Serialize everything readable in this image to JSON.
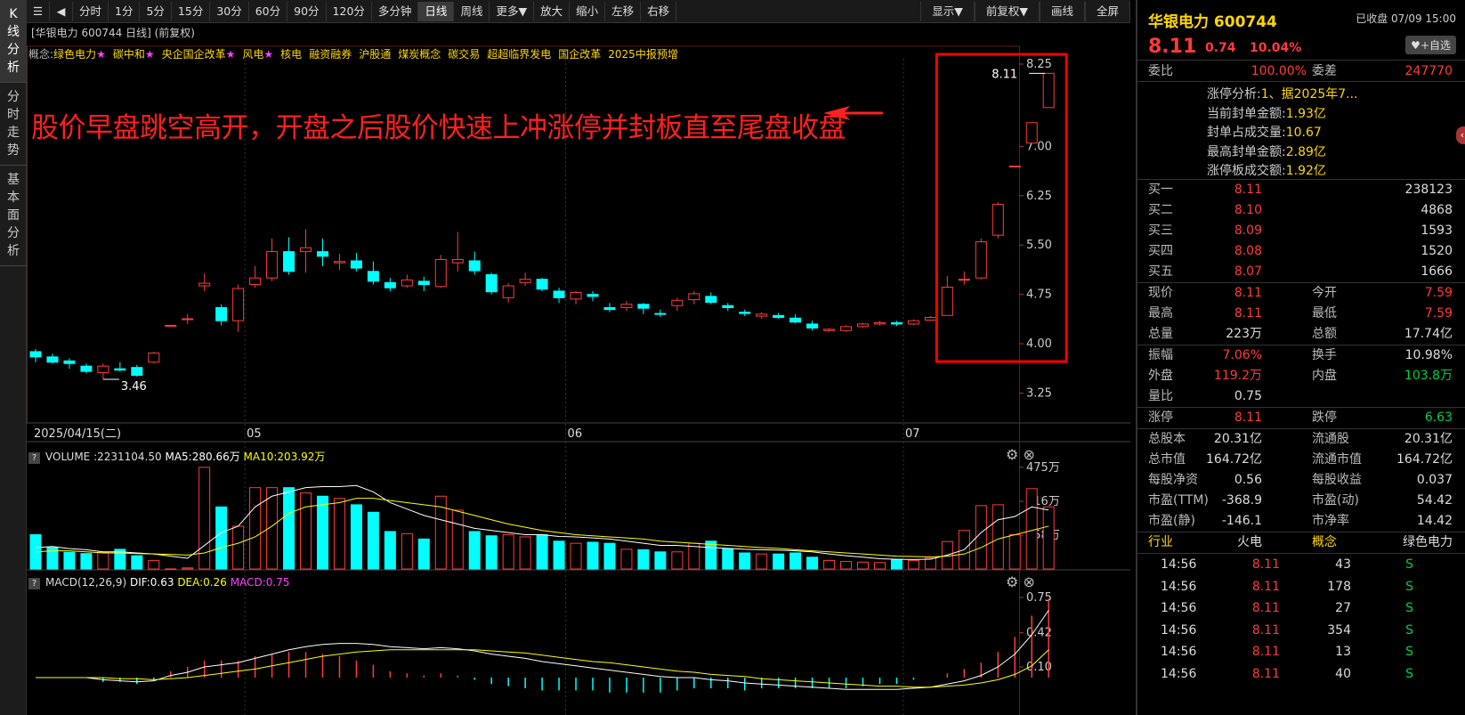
{
  "sidetabs": [
    "K线分析",
    "分时走势",
    "基本面分析"
  ],
  "toolbar": {
    "items": [
      "分时",
      "1分",
      "5分",
      "15分",
      "30分",
      "60分",
      "90分",
      "120分",
      "多分钟",
      "日线",
      "周线",
      "更多▼",
      "放大",
      "缩小",
      "左移",
      "右移"
    ],
    "active": "日线",
    "right": [
      "显示▼",
      "前复权▼",
      "画线",
      "全屏"
    ]
  },
  "chart_header": "[华银电力 600744 日线] (前复权)",
  "concepts": {
    "label": "概念:",
    "items": [
      {
        "t": "绿色电力",
        "star": true
      },
      {
        "t": "碳中和",
        "star": true
      },
      {
        "t": "央企国企改革",
        "star": true
      },
      {
        "t": "风电",
        "star": true
      },
      {
        "t": "核电",
        "star": false
      },
      {
        "t": "融资融券",
        "star": false
      },
      {
        "t": "沪股通",
        "star": false
      },
      {
        "t": "煤炭概念",
        "star": false
      },
      {
        "t": "碳交易",
        "star": false
      },
      {
        "t": "超超临界发电",
        "star": false
      },
      {
        "t": "国企改革",
        "star": false
      },
      {
        "t": "2025中报预增",
        "star": false
      }
    ]
  },
  "annotation": "股价早盘跳空高开，开盘之后股价快速上冲涨停并封板直至尾盘收盘",
  "price_axis": [
    "8.25",
    "7.00",
    "6.25",
    "5.50",
    "4.75",
    "4.00",
    "3.25"
  ],
  "date_axis": [
    "2025/04/15(二)",
    "05",
    "06",
    "07"
  ],
  "price_labels": {
    "high": "8.11",
    "low": "3.46"
  },
  "volume_panel": {
    "title": "VOLUME",
    "vol": ":2231104.50",
    "ma5": "MA5:280.66万",
    "ma10": "MA10:203.92万",
    "axis": [
      "475万",
      "316万",
      "158万"
    ]
  },
  "macd_panel": {
    "title": "MACD(12,26,9)",
    "dif": "DIF:0.63",
    "dea": "DEA:0.26",
    "macd": "MACD:0.75",
    "axis": [
      "0.75",
      "0.42",
      "0.10"
    ]
  },
  "colors": {
    "up": "#ff3b3b",
    "down": "#00ffff",
    "ma5": "#ffffff",
    "ma10": "#ffff00",
    "highlight": "#ff0000"
  },
  "chart_data": {
    "type": "candlestick",
    "candles": [
      [
        3.88,
        3.8,
        3.92,
        3.72
      ],
      [
        3.8,
        3.72,
        3.85,
        3.7
      ],
      [
        3.74,
        3.7,
        3.78,
        3.62
      ],
      [
        3.66,
        3.58,
        3.7,
        3.55
      ],
      [
        3.56,
        3.66,
        3.7,
        3.46
      ],
      [
        3.62,
        3.6,
        3.72,
        3.58
      ],
      [
        3.64,
        3.52,
        3.68,
        3.5
      ],
      [
        3.72,
        3.86,
        3.88,
        3.7
      ],
      [
        4.28,
        4.28,
        4.28,
        4.28
      ],
      [
        4.37,
        4.38,
        4.45,
        4.3
      ],
      [
        4.88,
        4.92,
        5.07,
        4.8
      ],
      [
        4.55,
        4.35,
        4.6,
        4.28
      ],
      [
        4.35,
        4.84,
        4.9,
        4.18
      ],
      [
        4.9,
        5.0,
        5.18,
        4.85
      ],
      [
        5.0,
        5.4,
        5.6,
        4.95
      ],
      [
        5.4,
        5.1,
        5.62,
        5.05
      ],
      [
        5.4,
        5.46,
        5.74,
        5.08
      ],
      [
        5.4,
        5.33,
        5.6,
        5.18
      ],
      [
        5.23,
        5.25,
        5.37,
        5.12
      ],
      [
        5.26,
        5.15,
        5.38,
        5.1
      ],
      [
        5.1,
        4.95,
        5.25,
        4.9
      ],
      [
        4.93,
        4.85,
        5.0,
        4.8
      ],
      [
        4.88,
        4.97,
        5.05,
        4.85
      ],
      [
        4.95,
        4.9,
        5.02,
        4.8
      ],
      [
        4.87,
        5.28,
        5.35,
        4.85
      ],
      [
        5.23,
        5.28,
        5.7,
        5.1
      ],
      [
        5.26,
        5.11,
        5.4,
        5.05
      ],
      [
        5.05,
        4.79,
        5.08,
        4.75
      ],
      [
        4.7,
        4.88,
        4.92,
        4.62
      ],
      [
        4.93,
        4.98,
        5.08,
        4.88
      ],
      [
        4.98,
        4.83,
        5.0,
        4.8
      ],
      [
        4.8,
        4.7,
        4.85,
        4.62
      ],
      [
        4.68,
        4.78,
        4.8,
        4.6
      ],
      [
        4.75,
        4.72,
        4.8,
        4.65
      ],
      [
        4.55,
        4.52,
        4.62,
        4.48
      ],
      [
        4.55,
        4.6,
        4.65,
        4.5
      ],
      [
        4.6,
        4.54,
        4.62,
        4.45
      ],
      [
        4.46,
        4.45,
        4.52,
        4.41
      ],
      [
        4.58,
        4.66,
        4.7,
        4.5
      ],
      [
        4.67,
        4.76,
        4.8,
        4.6
      ],
      [
        4.72,
        4.63,
        4.78,
        4.6
      ],
      [
        4.58,
        4.55,
        4.62,
        4.5
      ],
      [
        4.48,
        4.46,
        4.52,
        4.42
      ],
      [
        4.42,
        4.45,
        4.48,
        4.38
      ],
      [
        4.43,
        4.4,
        4.47,
        4.38
      ],
      [
        4.39,
        4.33,
        4.45,
        4.31
      ],
      [
        4.3,
        4.24,
        4.35,
        4.2
      ],
      [
        4.2,
        4.22,
        4.24,
        4.18
      ],
      [
        4.2,
        4.26,
        4.28,
        4.18
      ],
      [
        4.26,
        4.3,
        4.32,
        4.24
      ],
      [
        4.3,
        4.32,
        4.35,
        4.28
      ],
      [
        4.32,
        4.3,
        4.35,
        4.27
      ],
      [
        4.3,
        4.35,
        4.37,
        4.28
      ],
      [
        4.36,
        4.4,
        4.42,
        4.35
      ],
      [
        4.43,
        4.86,
        5.03,
        4.43
      ],
      [
        4.98,
        4.98,
        5.1,
        4.9
      ],
      [
        5.0,
        5.55,
        5.6,
        4.98
      ],
      [
        5.65,
        6.12,
        6.15,
        5.6
      ],
      [
        6.7,
        6.7,
        6.7,
        6.7
      ],
      [
        7.05,
        7.36,
        7.36,
        7.05
      ],
      [
        7.59,
        8.11,
        8.11,
        7.59
      ]
    ],
    "volume": [
      160,
      100,
      78,
      72,
      78,
      92,
      62,
      40,
      0.5,
      5,
      475,
      290,
      200,
      380,
      380,
      380,
      355,
      340,
      330,
      300,
      265,
      175,
      165,
      140,
      340,
      275,
      175,
      155,
      160,
      150,
      160,
      130,
      120,
      125,
      120,
      92,
      90,
      80,
      80,
      120,
      130,
      95,
      75,
      70,
      70,
      75,
      55,
      40,
      35,
      32,
      30,
      45,
      40,
      50,
      128,
      180,
      296,
      300,
      160,
      375,
      290
    ],
    "ma5": [
      100,
      105,
      95,
      90,
      80,
      80,
      75,
      70,
      60,
      50,
      110,
      170,
      200,
      290,
      340,
      360,
      380,
      385,
      385,
      390,
      360,
      310,
      280,
      250,
      230,
      210,
      190,
      180,
      170,
      160,
      160,
      152,
      150,
      145,
      140,
      130,
      120,
      110,
      110,
      105,
      100,
      96,
      92,
      90,
      88,
      85,
      80,
      70,
      62,
      55,
      48,
      45,
      44,
      46,
      65,
      90,
      170,
      230,
      245,
      290,
      275
    ],
    "ma10": [
      80,
      85,
      85,
      80,
      75,
      75,
      72,
      70,
      68,
      65,
      75,
      100,
      120,
      150,
      200,
      260,
      290,
      300,
      310,
      330,
      330,
      320,
      310,
      300,
      290,
      270,
      250,
      230,
      210,
      195,
      180,
      170,
      160,
      155,
      150,
      145,
      140,
      130,
      125,
      120,
      115,
      110,
      105,
      100,
      96,
      90,
      85,
      80,
      75,
      70,
      65,
      60,
      58,
      56,
      60,
      70,
      100,
      140,
      160,
      180,
      200
    ],
    "macd": {
      "dif": [
        0,
        0,
        0,
        0,
        -0.02,
        -0.03,
        -0.04,
        -0.03,
        0.02,
        0.05,
        0.1,
        0.12,
        0.14,
        0.18,
        0.22,
        0.26,
        0.29,
        0.31,
        0.32,
        0.32,
        0.31,
        0.29,
        0.28,
        0.27,
        0.28,
        0.27,
        0.25,
        0.22,
        0.2,
        0.18,
        0.15,
        0.13,
        0.11,
        0.09,
        0.07,
        0.05,
        0.03,
        0.01,
        0,
        0,
        -0.02,
        -0.03,
        -0.05,
        -0.06,
        -0.07,
        -0.08,
        -0.09,
        -0.1,
        -0.11,
        -0.11,
        -0.11,
        -0.11,
        -0.1,
        -0.09,
        -0.06,
        -0.03,
        0.02,
        0.1,
        0.22,
        0.4,
        0.63
      ],
      "dea": [
        0,
        0,
        0,
        0,
        0,
        -0.01,
        -0.01,
        -0.02,
        -0.01,
        0,
        0.02,
        0.04,
        0.06,
        0.08,
        0.11,
        0.14,
        0.17,
        0.2,
        0.22,
        0.24,
        0.25,
        0.26,
        0.26,
        0.26,
        0.26,
        0.26,
        0.26,
        0.25,
        0.24,
        0.23,
        0.21,
        0.19,
        0.17,
        0.15,
        0.14,
        0.12,
        0.1,
        0.08,
        0.06,
        0.05,
        0.03,
        0.02,
        0.01,
        -0.01,
        -0.02,
        -0.03,
        -0.04,
        -0.05,
        -0.06,
        -0.07,
        -0.08,
        -0.08,
        -0.09,
        -0.09,
        -0.08,
        -0.07,
        -0.05,
        -0.02,
        0.03,
        0.11,
        0.26
      ]
    },
    "ylim": [
      3.25,
      8.25
    ]
  },
  "right_panel": {
    "name": "华银电力 600744",
    "status": "已收盘 07/09 15:00",
    "price": "8.11",
    "change": "0.74",
    "pct": "10.04%",
    "add_btn": "+自选",
    "weibi": {
      "k1": "委比",
      "v1": "100.00%",
      "k2": "委差",
      "v2": "247770"
    },
    "limit": [
      {
        "k": "涨停分析:",
        "v": "1、据2025年7..."
      },
      {
        "k": "当前封单金额:",
        "v": "1.93亿"
      },
      {
        "k": "封单占成交量:",
        "v": "10.67"
      },
      {
        "k": "最高封单金额:",
        "v": "2.89亿"
      },
      {
        "k": "涨停板成交额:",
        "v": "1.92亿"
      }
    ],
    "bids": [
      {
        "k": "买一",
        "p": "8.11",
        "v": "238123"
      },
      {
        "k": "买二",
        "p": "8.10",
        "v": "4868"
      },
      {
        "k": "买三",
        "p": "8.09",
        "v": "1593"
      },
      {
        "k": "买四",
        "p": "8.08",
        "v": "1520"
      },
      {
        "k": "买五",
        "p": "8.07",
        "v": "1666"
      }
    ],
    "stats1": [
      {
        "k1": "现价",
        "v1": "8.11",
        "k2": "今开",
        "v2": "7.59"
      },
      {
        "k1": "最高",
        "v1": "8.11",
        "k2": "最低",
        "v2": "7.59"
      },
      {
        "k1": "总量",
        "v1": "223万",
        "k2": "总额",
        "v2": "17.74亿"
      }
    ],
    "stats2": [
      {
        "k1": "振幅",
        "v1": "7.06%",
        "k2": "换手",
        "v2": "10.98%"
      },
      {
        "k1": "外盘",
        "v1": "119.2万",
        "k2": "内盘",
        "v2": "103.8万"
      },
      {
        "k1": "量比",
        "v1": "0.75",
        "k2": "",
        "v2": ""
      }
    ],
    "limits": {
      "k1": "涨停",
      "v1": "8.11",
      "k2": "跌停",
      "v2": "6.63"
    },
    "fund": [
      {
        "k1": "总股本",
        "v1": "20.31亿",
        "k2": "流通股",
        "v2": "20.31亿"
      },
      {
        "k1": "总市值",
        "v1": "164.72亿",
        "k2": "流通市值",
        "v2": "164.72亿"
      },
      {
        "k1": "每股净资",
        "v1": "0.56",
        "k2": "每股收益",
        "v2": "0.037"
      },
      {
        "k1": "市盈(TTM)",
        "v1": "-368.9",
        "k2": "市盈(动)",
        "v2": "54.42"
      },
      {
        "k1": "市盈(静)",
        "v1": "-146.1",
        "k2": "市净率",
        "v2": "14.42"
      }
    ],
    "industry": {
      "k1": "行业",
      "v1": "火电",
      "k2": "概念",
      "v2": "绿色电力"
    },
    "ticks": [
      {
        "t": "14:56",
        "p": "8.11",
        "v": "43",
        "s": "S"
      },
      {
        "t": "14:56",
        "p": "8.11",
        "v": "178",
        "s": "S"
      },
      {
        "t": "14:56",
        "p": "8.11",
        "v": "27",
        "s": "S"
      },
      {
        "t": "14:56",
        "p": "8.11",
        "v": "354",
        "s": "S"
      },
      {
        "t": "14:56",
        "p": "8.11",
        "v": "13",
        "s": "S"
      },
      {
        "t": "14:56",
        "p": "8.11",
        "v": "40",
        "s": "S"
      }
    ]
  }
}
